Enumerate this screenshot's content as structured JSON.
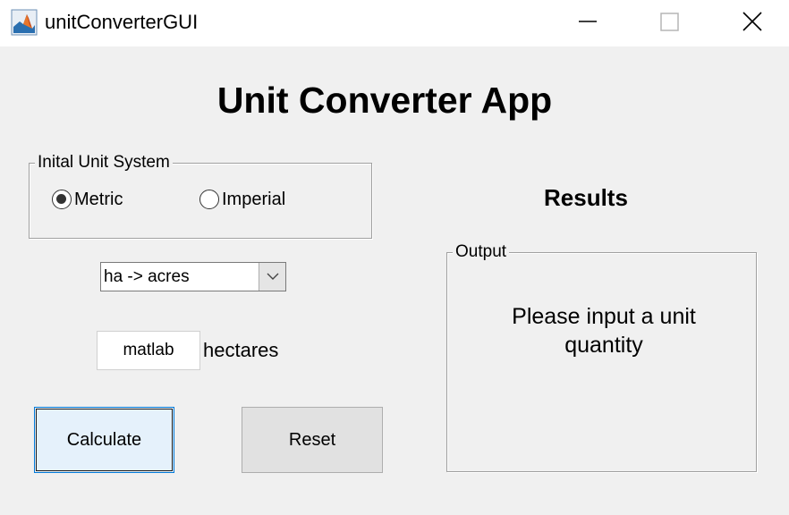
{
  "window": {
    "title": "unitConverterGUI",
    "icon": "matlab-icon"
  },
  "app": {
    "title": "Unit Converter App"
  },
  "unit_system": {
    "label": "Inital Unit System",
    "options": [
      {
        "label": "Metric",
        "selected": true
      },
      {
        "label": "Imperial",
        "selected": false
      }
    ]
  },
  "conversion": {
    "selected": "ha -> acres"
  },
  "quantity": {
    "value": "matlab",
    "unit": "hectares"
  },
  "buttons": {
    "calculate": "Calculate",
    "reset": "Reset"
  },
  "results": {
    "heading": "Results",
    "output_label": "Output",
    "output_text": "Please input a unit quantity"
  },
  "colors": {
    "background": "#f0f0f0",
    "calculate_button_bg": "#e5f1fb",
    "calculate_button_border": "#0078d7"
  }
}
